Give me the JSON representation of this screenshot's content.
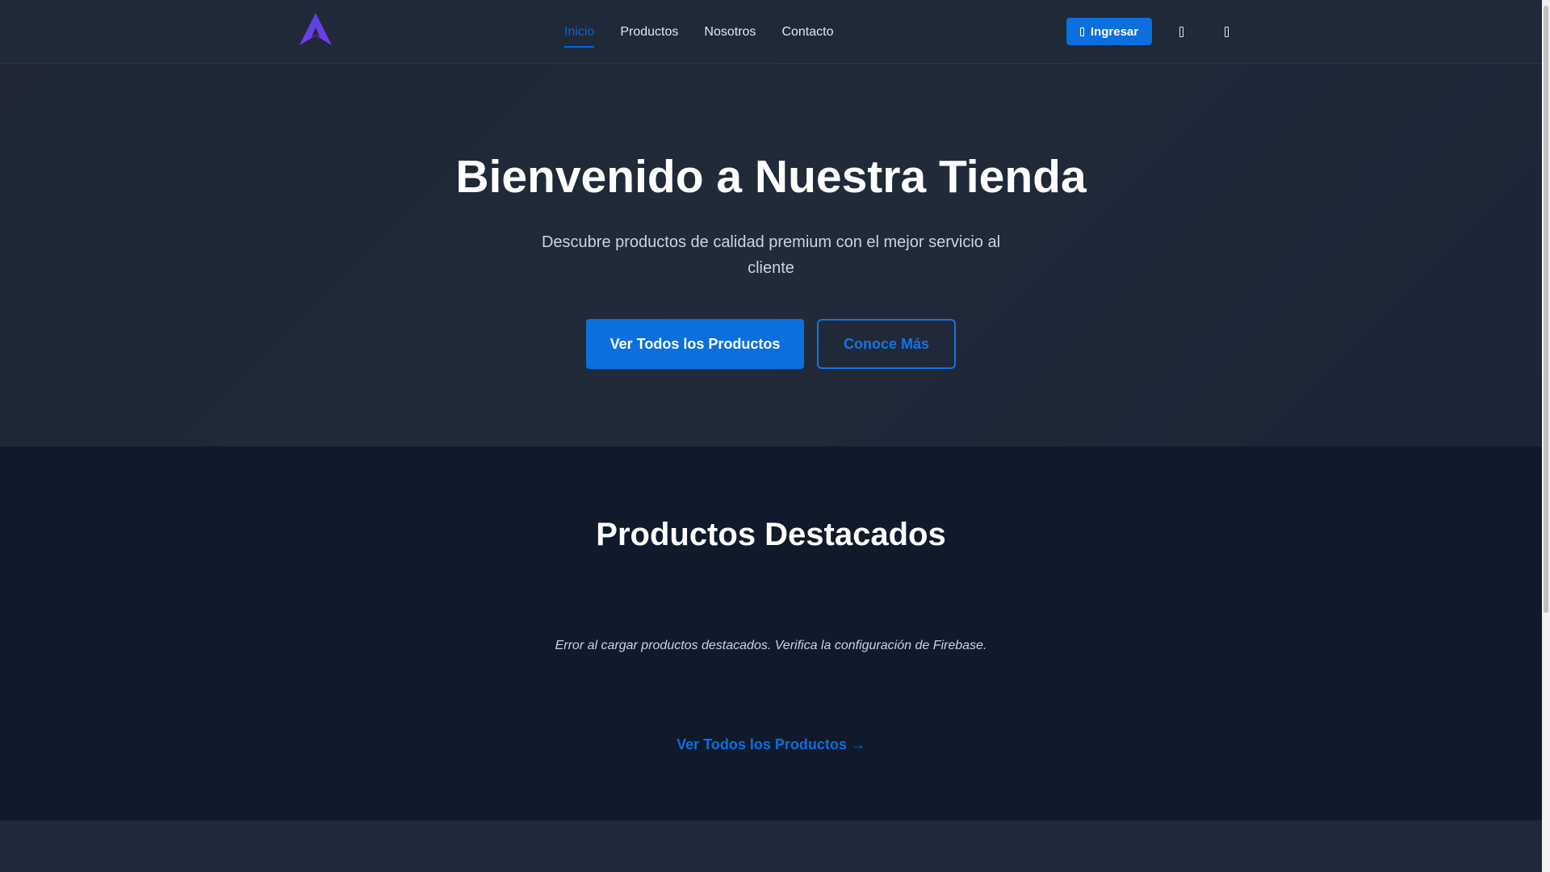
{
  "nav": {
    "links": [
      {
        "label": "Inicio",
        "active": true
      },
      {
        "label": "Productos",
        "active": false
      },
      {
        "label": "Nosotros",
        "active": false
      },
      {
        "label": "Contacto",
        "active": false
      }
    ],
    "login_label": "Ingresar"
  },
  "hero": {
    "title": "Bienvenido a Nuestra Tienda",
    "subtitle": "Descubre productos de calidad premium con el mejor servicio al cliente",
    "primary_button": "Ver Todos los Productos",
    "secondary_button": "Conoce Más"
  },
  "featured": {
    "title": "Productos Destacados",
    "error_message": "Error al cargar productos destacados. Verifica la configuración de Firebase.",
    "view_all_link": "Ver Todos los Productos →"
  },
  "icons": {
    "logo": "logo-a-icon",
    "login": "user-icon",
    "cart": "cart-icon",
    "menu": "menu-icon"
  },
  "colors": {
    "accent": "#0b6fde",
    "logo_gradient": [
      "#4f46e5",
      "#7c3aed"
    ],
    "navbar_bg": "#1f2937",
    "featured_bg": "#111a2b"
  }
}
